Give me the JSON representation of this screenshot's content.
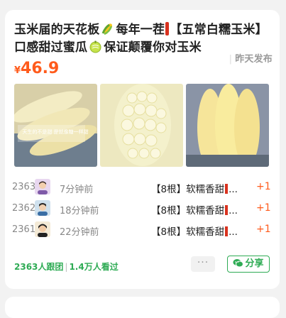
{
  "post": {
    "title_part1": "玉米届的天花板",
    "title_part2": "每年一茬",
    "title_part3": "【五常白糯玉米】口感甜过蜜瓜",
    "title_part4": "保证颠覆你对玉米",
    "posted": "昨天发布",
    "price_currency": "¥",
    "price_value": "46.9"
  },
  "images": [
    {
      "caption": "天生的不是甜 是就像糖一样甜"
    },
    {
      "caption": ""
    },
    {
      "caption": ""
    }
  ],
  "buyers": [
    {
      "count": "2363",
      "time": "7分钟前",
      "product": "【8根】软糯香甜",
      "ellipsis": "...",
      "qty": "+1"
    },
    {
      "count": "2362",
      "time": "18分钟前",
      "product": "【8根】软糯香甜",
      "ellipsis": "...",
      "qty": "+1"
    },
    {
      "count": "2361",
      "time": "22分钟前",
      "product": "【8根】软糯香甜",
      "ellipsis": "...",
      "qty": "+1"
    }
  ],
  "footer": {
    "followers": "2363人跟团",
    "views": "1.4万人看过",
    "more_label": "···",
    "share_label": "分享"
  },
  "colors": {
    "price": "#ff5b1c",
    "accent_green": "#2eab54",
    "tag_red": "#d9321f"
  },
  "icons": [
    "corn-icon",
    "melon-icon",
    "avatar",
    "wechat-icon"
  ]
}
